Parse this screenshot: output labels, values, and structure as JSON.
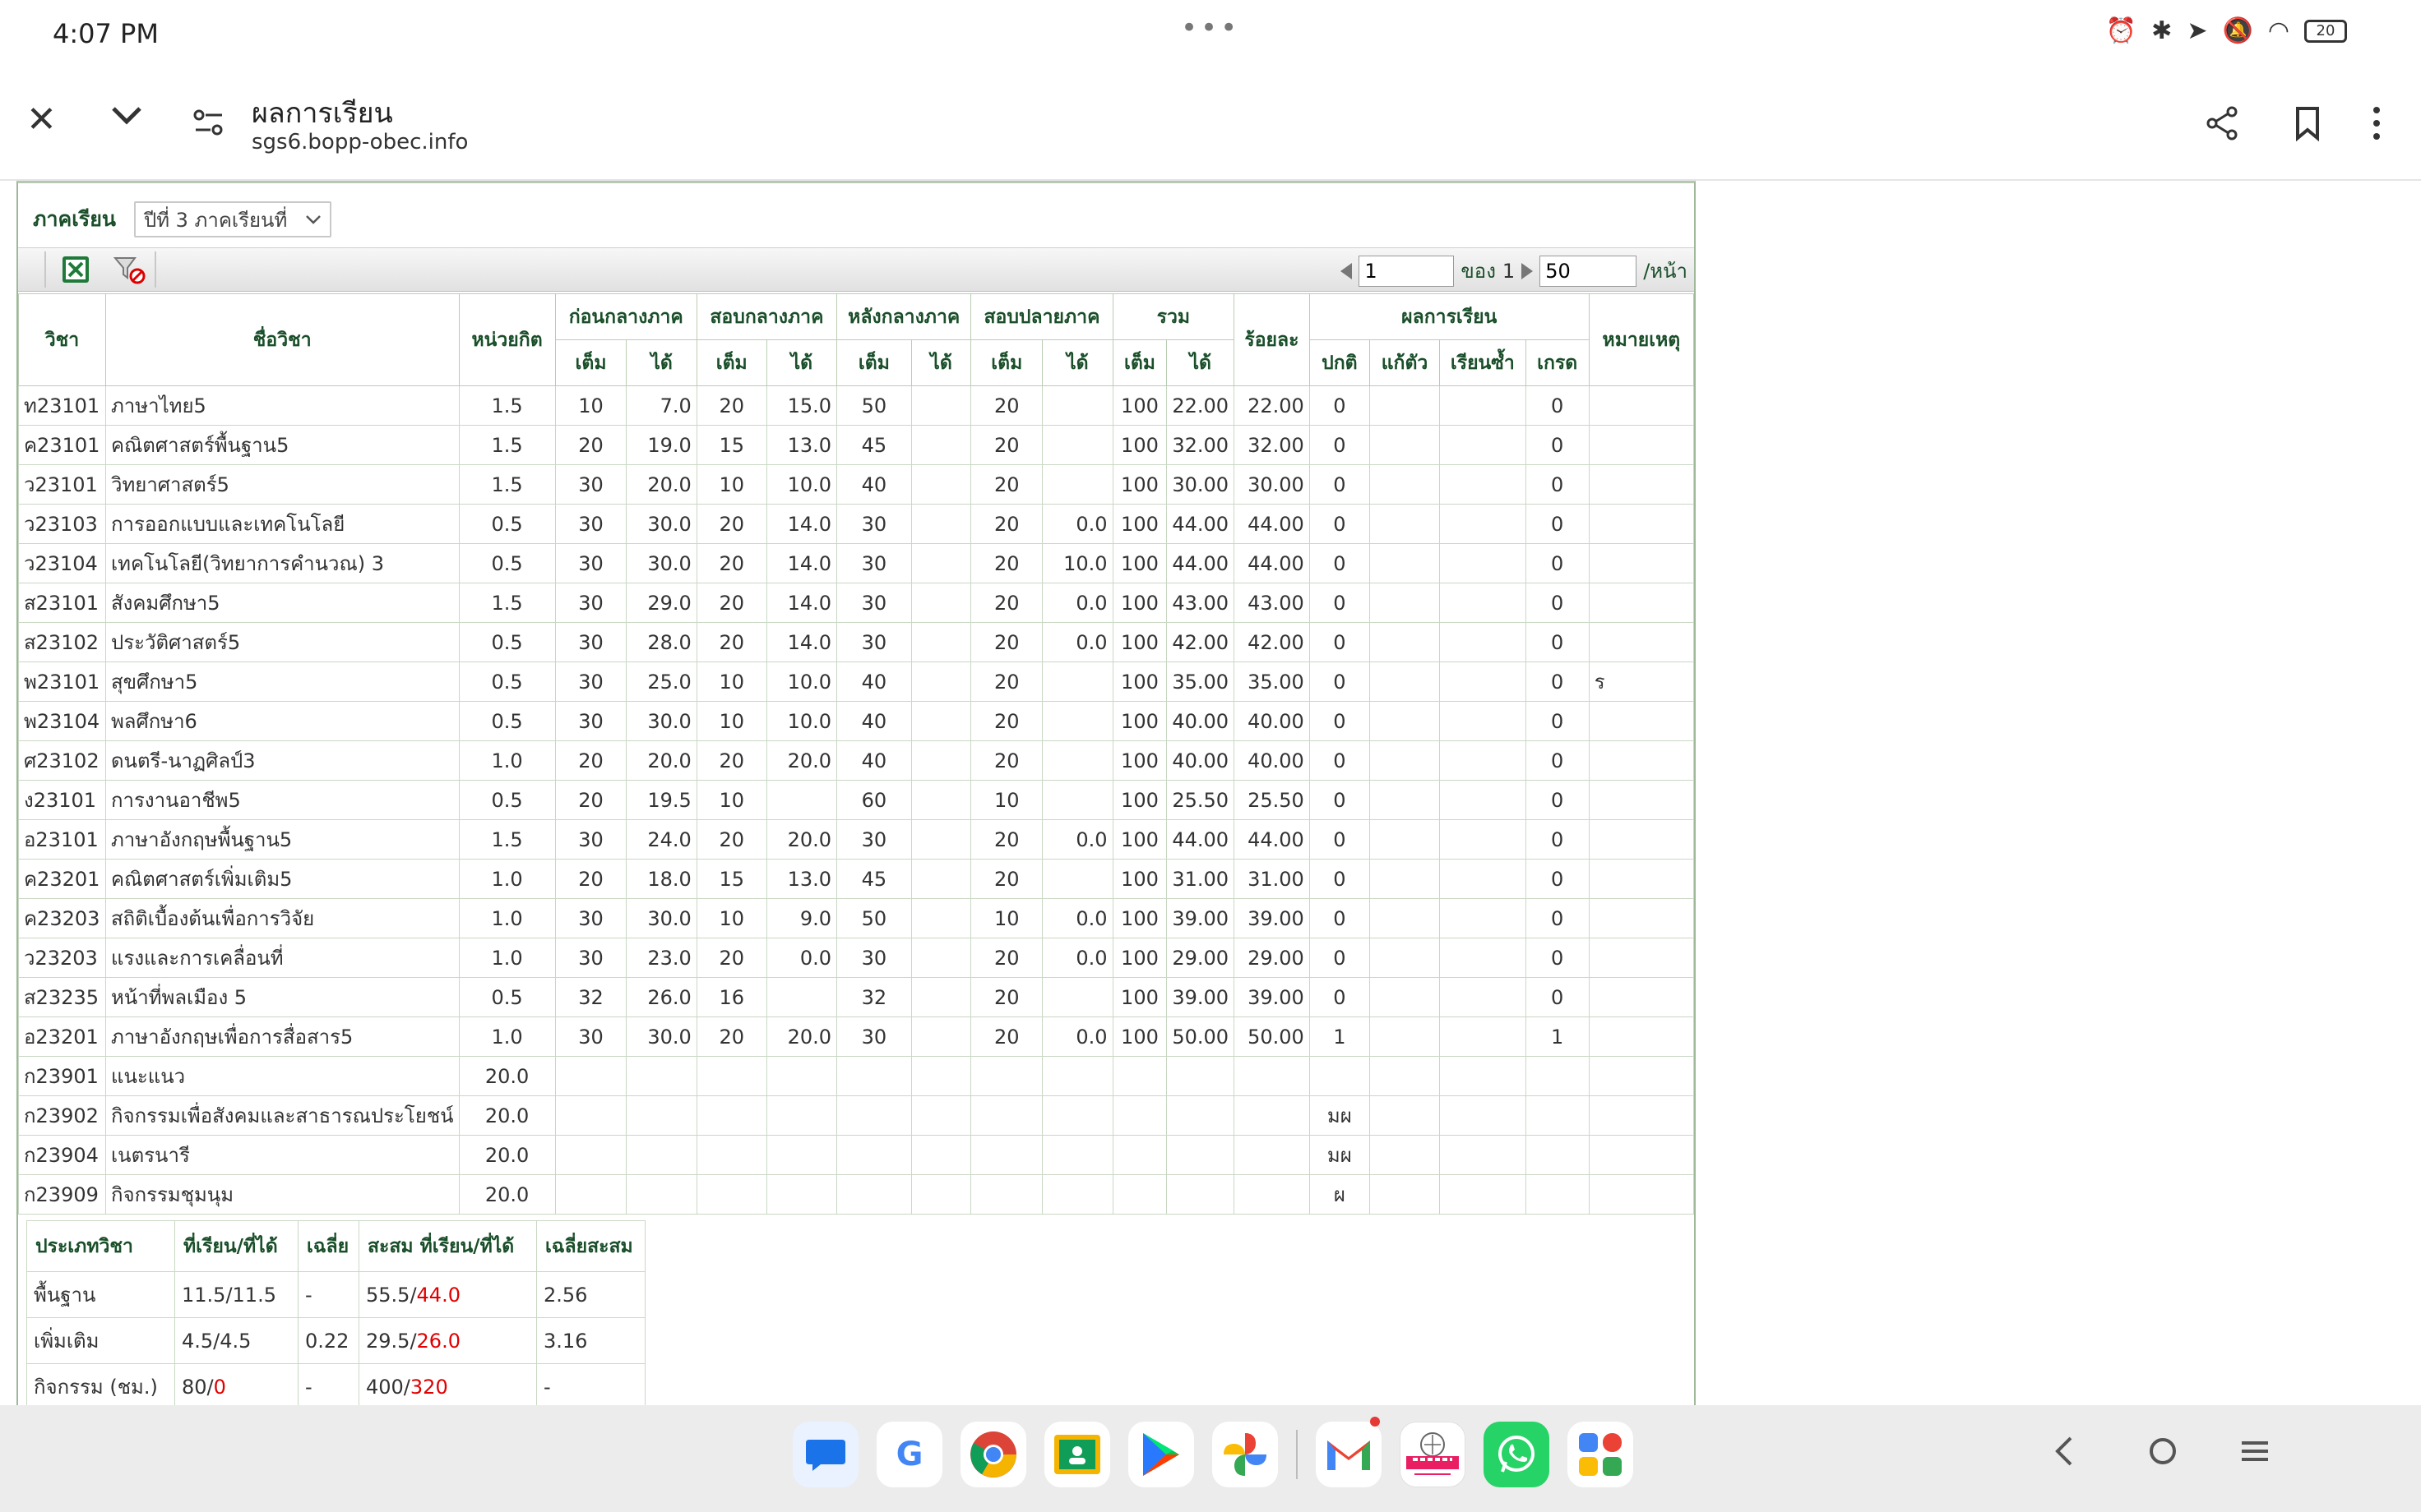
{
  "status_bar": {
    "time": "4:07 PM",
    "battery": "20"
  },
  "browser": {
    "title": "ผลการเรียน",
    "url": "sgs6.bopp-obec.info"
  },
  "semester": {
    "label": "ภาคเรียน",
    "selected": "ปีที่  3  ภาคเรียนที่"
  },
  "pager": {
    "page": "1",
    "of_label": "ของ",
    "total": "1",
    "per_page": "50",
    "per_page_label": "/หน้า"
  },
  "table": {
    "headers": {
      "code": "วิชา",
      "name": "ชื่อวิชา",
      "credit": "หน่วยกิต",
      "pre_mid": "ก่อนกลางภาค",
      "midterm": "สอบกลางภาค",
      "post_mid": "หลังกลางภาค",
      "final": "สอบปลายภาค",
      "total": "รวม",
      "percent": "ร้อยละ",
      "result": "ผลการเรียน",
      "remark": "หมายเหตุ",
      "full": "เต็ม",
      "got": "ได้",
      "normal": "ปกติ",
      "fix": "แก้ตัว",
      "repeat": "เรียนซ้ำ",
      "grade": "เกรด"
    },
    "rows": [
      {
        "code": "ท23101",
        "name": "ภาษาไทย5",
        "credit": "1.5",
        "pre_full": "10",
        "pre_got": "7.0",
        "mid_full": "20",
        "mid_got": "15.0",
        "post_full": "50",
        "post_got": "",
        "fin_full": "20",
        "fin_got": "",
        "tot_full": "100",
        "tot_got": "22.00",
        "pct": "22.00",
        "normal": "0",
        "fix": "",
        "repeat": "",
        "grade": "0",
        "remark": ""
      },
      {
        "code": "ค23101",
        "name": "คณิตศาสตร์พื้นฐาน5",
        "credit": "1.5",
        "pre_full": "20",
        "pre_got": "19.0",
        "mid_full": "15",
        "mid_got": "13.0",
        "post_full": "45",
        "post_got": "",
        "fin_full": "20",
        "fin_got": "",
        "tot_full": "100",
        "tot_got": "32.00",
        "pct": "32.00",
        "normal": "0",
        "fix": "",
        "repeat": "",
        "grade": "0",
        "remark": ""
      },
      {
        "code": "ว23101",
        "name": "วิทยาศาสตร์5",
        "credit": "1.5",
        "pre_full": "30",
        "pre_got": "20.0",
        "mid_full": "10",
        "mid_got": "10.0",
        "post_full": "40",
        "post_got": "",
        "fin_full": "20",
        "fin_got": "",
        "tot_full": "100",
        "tot_got": "30.00",
        "pct": "30.00",
        "normal": "0",
        "fix": "",
        "repeat": "",
        "grade": "0",
        "remark": ""
      },
      {
        "code": "ว23103",
        "name": "การออกแบบและเทคโนโลยี",
        "credit": "0.5",
        "pre_full": "30",
        "pre_got": "30.0",
        "mid_full": "20",
        "mid_got": "14.0",
        "post_full": "30",
        "post_got": "",
        "fin_full": "20",
        "fin_got": "0.0",
        "tot_full": "100",
        "tot_got": "44.00",
        "pct": "44.00",
        "normal": "0",
        "fix": "",
        "repeat": "",
        "grade": "0",
        "remark": ""
      },
      {
        "code": "ว23104",
        "name": "เทคโนโลยี(วิทยาการคำนวณ) 3",
        "credit": "0.5",
        "pre_full": "30",
        "pre_got": "30.0",
        "mid_full": "20",
        "mid_got": "14.0",
        "post_full": "30",
        "post_got": "",
        "fin_full": "20",
        "fin_got": "10.0",
        "tot_full": "100",
        "tot_got": "44.00",
        "pct": "44.00",
        "normal": "0",
        "fix": "",
        "repeat": "",
        "grade": "0",
        "remark": ""
      },
      {
        "code": "ส23101",
        "name": "สังคมศึกษา5",
        "credit": "1.5",
        "pre_full": "30",
        "pre_got": "29.0",
        "mid_full": "20",
        "mid_got": "14.0",
        "post_full": "30",
        "post_got": "",
        "fin_full": "20",
        "fin_got": "0.0",
        "tot_full": "100",
        "tot_got": "43.00",
        "pct": "43.00",
        "normal": "0",
        "fix": "",
        "repeat": "",
        "grade": "0",
        "remark": ""
      },
      {
        "code": "ส23102",
        "name": "ประวัติศาสตร์5",
        "credit": "0.5",
        "pre_full": "30",
        "pre_got": "28.0",
        "mid_full": "20",
        "mid_got": "14.0",
        "post_full": "30",
        "post_got": "",
        "fin_full": "20",
        "fin_got": "0.0",
        "tot_full": "100",
        "tot_got": "42.00",
        "pct": "42.00",
        "normal": "0",
        "fix": "",
        "repeat": "",
        "grade": "0",
        "remark": ""
      },
      {
        "code": "พ23101",
        "name": "สุขศึกษา5",
        "credit": "0.5",
        "pre_full": "30",
        "pre_got": "25.0",
        "mid_full": "10",
        "mid_got": "10.0",
        "post_full": "40",
        "post_got": "",
        "fin_full": "20",
        "fin_got": "",
        "tot_full": "100",
        "tot_got": "35.00",
        "pct": "35.00",
        "normal": "0",
        "fix": "",
        "repeat": "",
        "grade": "0",
        "remark": "ร"
      },
      {
        "code": "พ23104",
        "name": "พลศึกษา6",
        "credit": "0.5",
        "pre_full": "30",
        "pre_got": "30.0",
        "mid_full": "10",
        "mid_got": "10.0",
        "post_full": "40",
        "post_got": "",
        "fin_full": "20",
        "fin_got": "",
        "tot_full": "100",
        "tot_got": "40.00",
        "pct": "40.00",
        "normal": "0",
        "fix": "",
        "repeat": "",
        "grade": "0",
        "remark": ""
      },
      {
        "code": "ศ23102",
        "name": "ดนตรี-นาฏศิลป์3",
        "credit": "1.0",
        "pre_full": "20",
        "pre_got": "20.0",
        "mid_full": "20",
        "mid_got": "20.0",
        "post_full": "40",
        "post_got": "",
        "fin_full": "20",
        "fin_got": "",
        "tot_full": "100",
        "tot_got": "40.00",
        "pct": "40.00",
        "normal": "0",
        "fix": "",
        "repeat": "",
        "grade": "0",
        "remark": ""
      },
      {
        "code": "ง23101",
        "name": "การงานอาชีพ5",
        "credit": "0.5",
        "pre_full": "20",
        "pre_got": "19.5",
        "mid_full": "10",
        "mid_got": "",
        "post_full": "60",
        "post_got": "",
        "fin_full": "10",
        "fin_got": "",
        "tot_full": "100",
        "tot_got": "25.50",
        "pct": "25.50",
        "normal": "0",
        "fix": "",
        "repeat": "",
        "grade": "0",
        "remark": ""
      },
      {
        "code": "อ23101",
        "name": "ภาษาอังกฤษพื้นฐาน5",
        "credit": "1.5",
        "pre_full": "30",
        "pre_got": "24.0",
        "mid_full": "20",
        "mid_got": "20.0",
        "post_full": "30",
        "post_got": "",
        "fin_full": "20",
        "fin_got": "0.0",
        "tot_full": "100",
        "tot_got": "44.00",
        "pct": "44.00",
        "normal": "0",
        "fix": "",
        "repeat": "",
        "grade": "0",
        "remark": ""
      },
      {
        "code": "ค23201",
        "name": "คณิตศาสตร์เพิ่มเติม5",
        "credit": "1.0",
        "pre_full": "20",
        "pre_got": "18.0",
        "mid_full": "15",
        "mid_got": "13.0",
        "post_full": "45",
        "post_got": "",
        "fin_full": "20",
        "fin_got": "",
        "tot_full": "100",
        "tot_got": "31.00",
        "pct": "31.00",
        "normal": "0",
        "fix": "",
        "repeat": "",
        "grade": "0",
        "remark": ""
      },
      {
        "code": "ค23203",
        "name": "สถิติเบื้องต้นเพื่อการวิจัย",
        "credit": "1.0",
        "pre_full": "30",
        "pre_got": "30.0",
        "mid_full": "10",
        "mid_got": "9.0",
        "post_full": "50",
        "post_got": "",
        "fin_full": "10",
        "fin_got": "0.0",
        "tot_full": "100",
        "tot_got": "39.00",
        "pct": "39.00",
        "normal": "0",
        "fix": "",
        "repeat": "",
        "grade": "0",
        "remark": ""
      },
      {
        "code": "ว23203",
        "name": "แรงและการเคลื่อนที่",
        "credit": "1.0",
        "pre_full": "30",
        "pre_got": "23.0",
        "mid_full": "20",
        "mid_got": "0.0",
        "post_full": "30",
        "post_got": "",
        "fin_full": "20",
        "fin_got": "0.0",
        "tot_full": "100",
        "tot_got": "29.00",
        "pct": "29.00",
        "normal": "0",
        "fix": "",
        "repeat": "",
        "grade": "0",
        "remark": ""
      },
      {
        "code": "ส23235",
        "name": "หน้าที่พลเมือง 5",
        "credit": "0.5",
        "pre_full": "32",
        "pre_got": "26.0",
        "mid_full": "16",
        "mid_got": "",
        "post_full": "32",
        "post_got": "",
        "fin_full": "20",
        "fin_got": "",
        "tot_full": "100",
        "tot_got": "39.00",
        "pct": "39.00",
        "normal": "0",
        "fix": "",
        "repeat": "",
        "grade": "0",
        "remark": ""
      },
      {
        "code": "อ23201",
        "name": "ภาษาอังกฤษเพื่อการสื่อสาร5",
        "credit": "1.0",
        "pre_full": "30",
        "pre_got": "30.0",
        "mid_full": "20",
        "mid_got": "20.0",
        "post_full": "30",
        "post_got": "",
        "fin_full": "20",
        "fin_got": "0.0",
        "tot_full": "100",
        "tot_got": "50.00",
        "pct": "50.00",
        "normal": "1",
        "fix": "",
        "repeat": "",
        "grade": "1",
        "remark": ""
      },
      {
        "code": "ก23901",
        "name": "แนะแนว",
        "credit": "20.0",
        "pre_full": "",
        "pre_got": "",
        "mid_full": "",
        "mid_got": "",
        "post_full": "",
        "post_got": "",
        "fin_full": "",
        "fin_got": "",
        "tot_full": "",
        "tot_got": "",
        "pct": "",
        "normal": "",
        "fix": "",
        "repeat": "",
        "grade": "",
        "remark": ""
      },
      {
        "code": "ก23902",
        "name": "กิจกรรมเพื่อสังคมและสาธารณประโยชน์",
        "credit": "20.0",
        "pre_full": "",
        "pre_got": "",
        "mid_full": "",
        "mid_got": "",
        "post_full": "",
        "post_got": "",
        "fin_full": "",
        "fin_got": "",
        "tot_full": "",
        "tot_got": "",
        "pct": "",
        "normal": "มผ",
        "fix": "",
        "repeat": "",
        "grade": "",
        "remark": ""
      },
      {
        "code": "ก23904",
        "name": "เนตรนารี",
        "credit": "20.0",
        "pre_full": "",
        "pre_got": "",
        "mid_full": "",
        "mid_got": "",
        "post_full": "",
        "post_got": "",
        "fin_full": "",
        "fin_got": "",
        "tot_full": "",
        "tot_got": "",
        "pct": "",
        "normal": "มผ",
        "fix": "",
        "repeat": "",
        "grade": "",
        "remark": ""
      },
      {
        "code": "ก23909",
        "name": "กิจกรรมชุมนุม",
        "credit": "20.0",
        "pre_full": "",
        "pre_got": "",
        "mid_full": "",
        "mid_got": "",
        "post_full": "",
        "post_got": "",
        "fin_full": "",
        "fin_got": "",
        "tot_full": "",
        "tot_got": "",
        "pct": "",
        "normal": "ผ",
        "fix": "",
        "repeat": "",
        "grade": "",
        "remark": ""
      }
    ]
  },
  "summary": {
    "headers": {
      "type": "ประเภทวิชา",
      "studied": "ที่เรียน/ที่ได้",
      "avg": "เฉลี่ย",
      "cum": "สะสม  ที่เรียน/ที่ได้",
      "cum_avg": "เฉลี่ยสะสม"
    },
    "rows": [
      {
        "type": "พื้นฐาน",
        "studied_a": "11.5/11.5",
        "studied_b": "",
        "avg": "-",
        "cum_a": "55.5/",
        "cum_b": "44.0",
        "cum_avg": "2.56"
      },
      {
        "type": "เพิ่มเติม",
        "studied_a": "4.5/4.5",
        "studied_b": "",
        "avg": "0.22",
        "cum_a": "29.5/",
        "cum_b": "26.0",
        "cum_avg": "3.16"
      },
      {
        "type": "กิจกรรม  (ชม.)",
        "studied_a": "80/",
        "studied_b": "0",
        "avg": "-",
        "cum_a": "400/",
        "cum_b": "320",
        "cum_avg": "-"
      }
    ]
  },
  "colors": {
    "header_text": "#1a4f2a",
    "grid_border": "#c9d8c3",
    "grade_red": "#e00000"
  }
}
